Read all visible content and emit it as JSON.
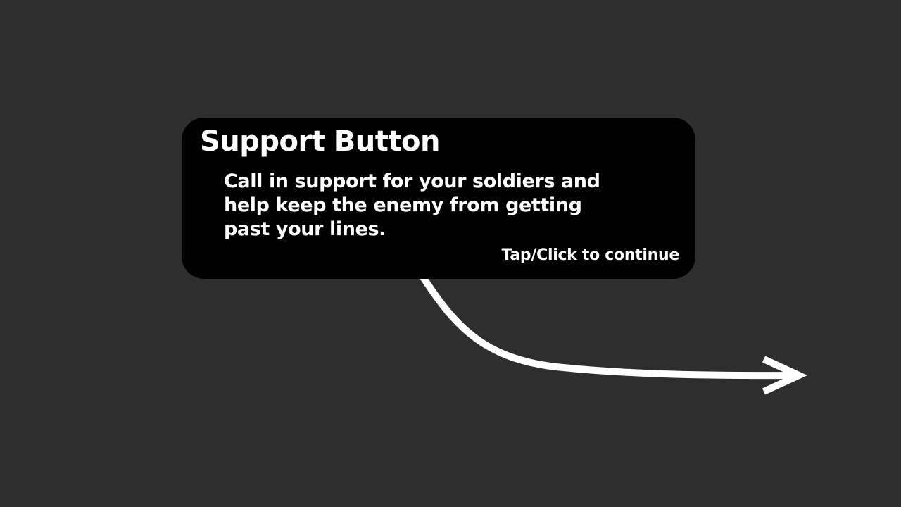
{
  "tutorial": {
    "title": "Support Button",
    "body_lines": [
      "Call in support for your soldiers and",
      "help keep the enemy from getting",
      "past your lines."
    ],
    "continue_hint": "Tap/Click to continue"
  },
  "icons": {
    "pointer": "curved-arrow-icon"
  },
  "colors": {
    "background": "#2e2e2e",
    "tooltip_background": "#000000",
    "text": "#ffffff",
    "arrow": "#ffffff"
  }
}
